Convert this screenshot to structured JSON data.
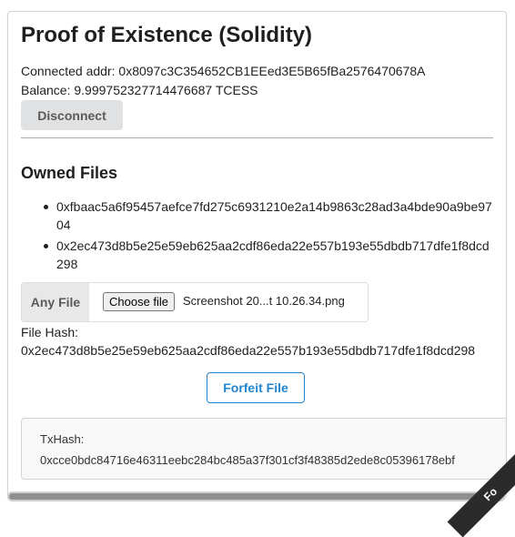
{
  "app": {
    "title": "Proof of Existence (Solidity)",
    "connected_addr": "Connected addr: 0x8097c3C354652CB1EEed3E5B65fBa2576470678A",
    "balance": "Balance: 9.999752327714476687 TCESS",
    "disconnect_label": "Disconnect"
  },
  "owned_files": {
    "heading": "Owned Files",
    "items": [
      "0xfbaac5a6f95457aefce7fd275c6931210e2a14b9863c28ad3a4bde90a9be9704",
      "0x2ec473d8b5e25e59eb625aa2cdf86eda22e557b193e55dbdb717dfe1f8dcd298"
    ]
  },
  "file_input": {
    "label": "Any File",
    "choose_label": "Choose file",
    "selected_name": "Screenshot 20...t 10.26.34.png"
  },
  "file_hash": {
    "label": "File Hash:",
    "value": "0x2ec473d8b5e25e59eb625aa2cdf86eda22e557b193e55dbdb717dfe1f8dcd298"
  },
  "forfeit_label": "Forfeit File",
  "tx": {
    "label": "TxHash:",
    "value": "0xcce0bdc84716e46311eebc284bc485a37f301cf3f48385d2ede8c05396178ebf"
  },
  "ribbon_text": "Fo",
  "colors": {
    "accent": "#2185d0",
    "button_grey": "#e0e1e2",
    "divider": "#a9a9a9"
  }
}
